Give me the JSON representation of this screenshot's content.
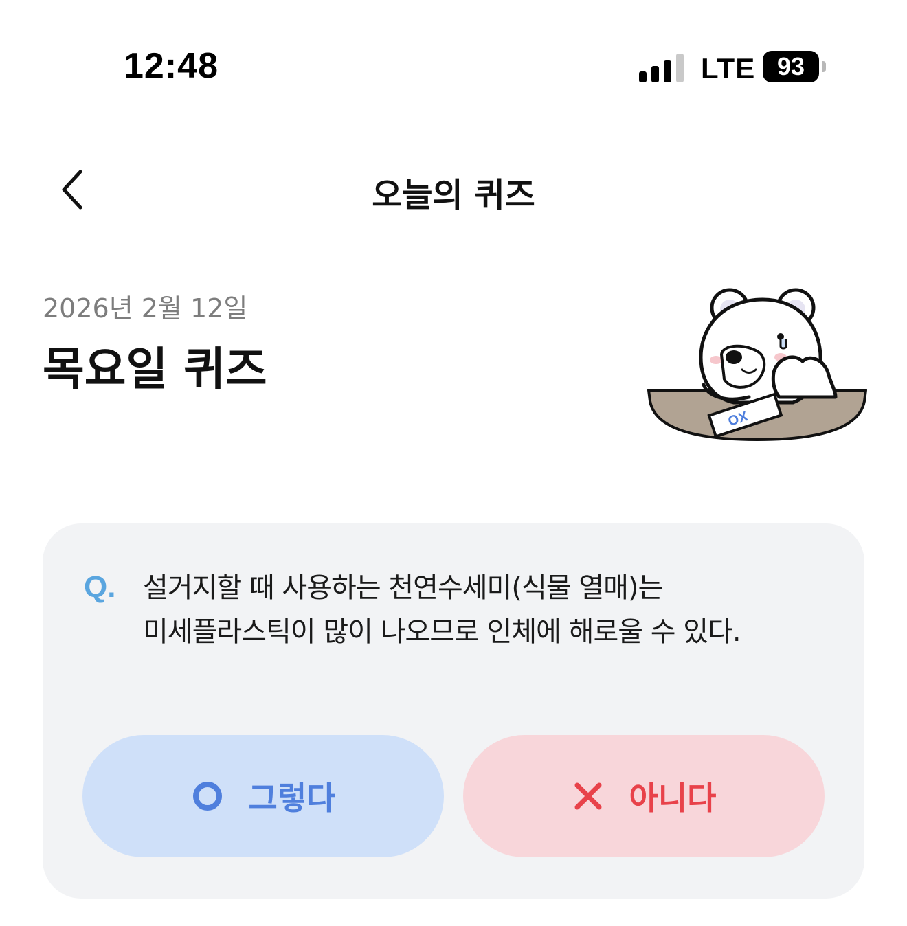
{
  "status_bar": {
    "time": "12:48",
    "network": "LTE",
    "battery": "93"
  },
  "nav": {
    "title": "오늘의 퀴즈"
  },
  "header": {
    "date": "2026년 2월 12일",
    "title": "목요일 퀴즈"
  },
  "quiz": {
    "q_label": "Q.",
    "question_line1": "설거지할 때 사용하는 천연수세미(식물 열매)는",
    "question_line2": "미세플라스틱이 많이 나오므로 인체에 해로울 수 있다.",
    "answer_yes": "그렇다",
    "answer_no": "아니다",
    "paper_text": "OX"
  },
  "colors": {
    "q_accent": "#5aa5df",
    "yes_bg": "#cfe0f9",
    "yes_fg": "#4f7fdd",
    "no_bg": "#f8d6da",
    "no_fg": "#e8424a",
    "card_bg": "#f2f3f5"
  },
  "icons": {
    "back": "chevron-left-icon",
    "yes": "circle-o-icon",
    "no": "x-mark-icon",
    "mascot": "bear-illustration"
  }
}
